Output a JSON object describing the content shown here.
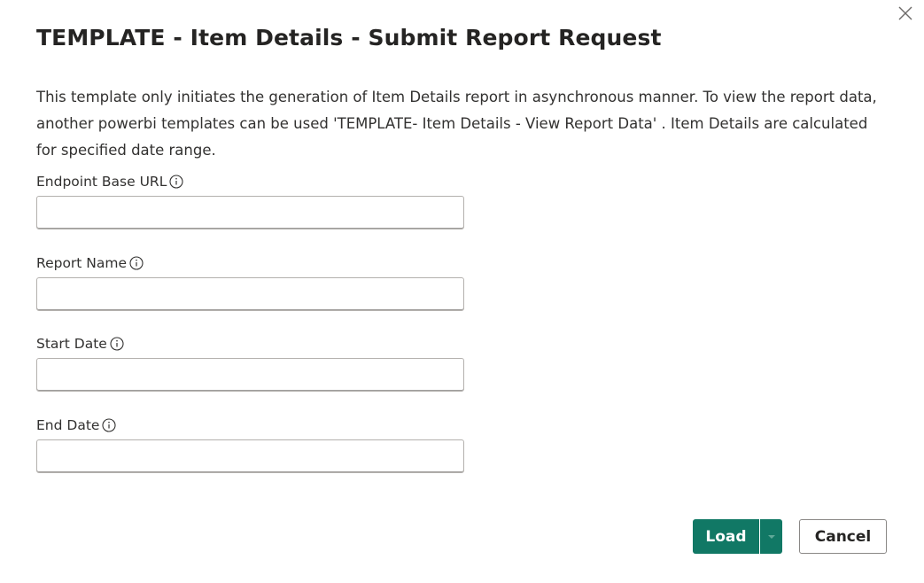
{
  "dialog": {
    "title": "TEMPLATE - Item Details - Submit Report Request",
    "description": "This template only initiates the generation of Item Details report in asynchronous manner. To view the report data, another powerbi templates can be used 'TEMPLATE- Item Details - View Report Data' . Item Details are calculated for specified date range.",
    "close_icon": "close-icon"
  },
  "fields": [
    {
      "label": "Endpoint Base URL",
      "value": "",
      "icon": "info-icon"
    },
    {
      "label": "Report Name",
      "value": "",
      "icon": "info-icon"
    },
    {
      "label": "Start Date",
      "value": "",
      "icon": "info-icon"
    },
    {
      "label": "End Date",
      "value": "",
      "icon": "info-icon"
    }
  ],
  "footer": {
    "load_label": "Load",
    "load_dropdown_icon": "caret-down-icon",
    "cancel_label": "Cancel"
  },
  "colors": {
    "primary": "#117865",
    "text": "#252423",
    "border": "#b3b0ad"
  }
}
